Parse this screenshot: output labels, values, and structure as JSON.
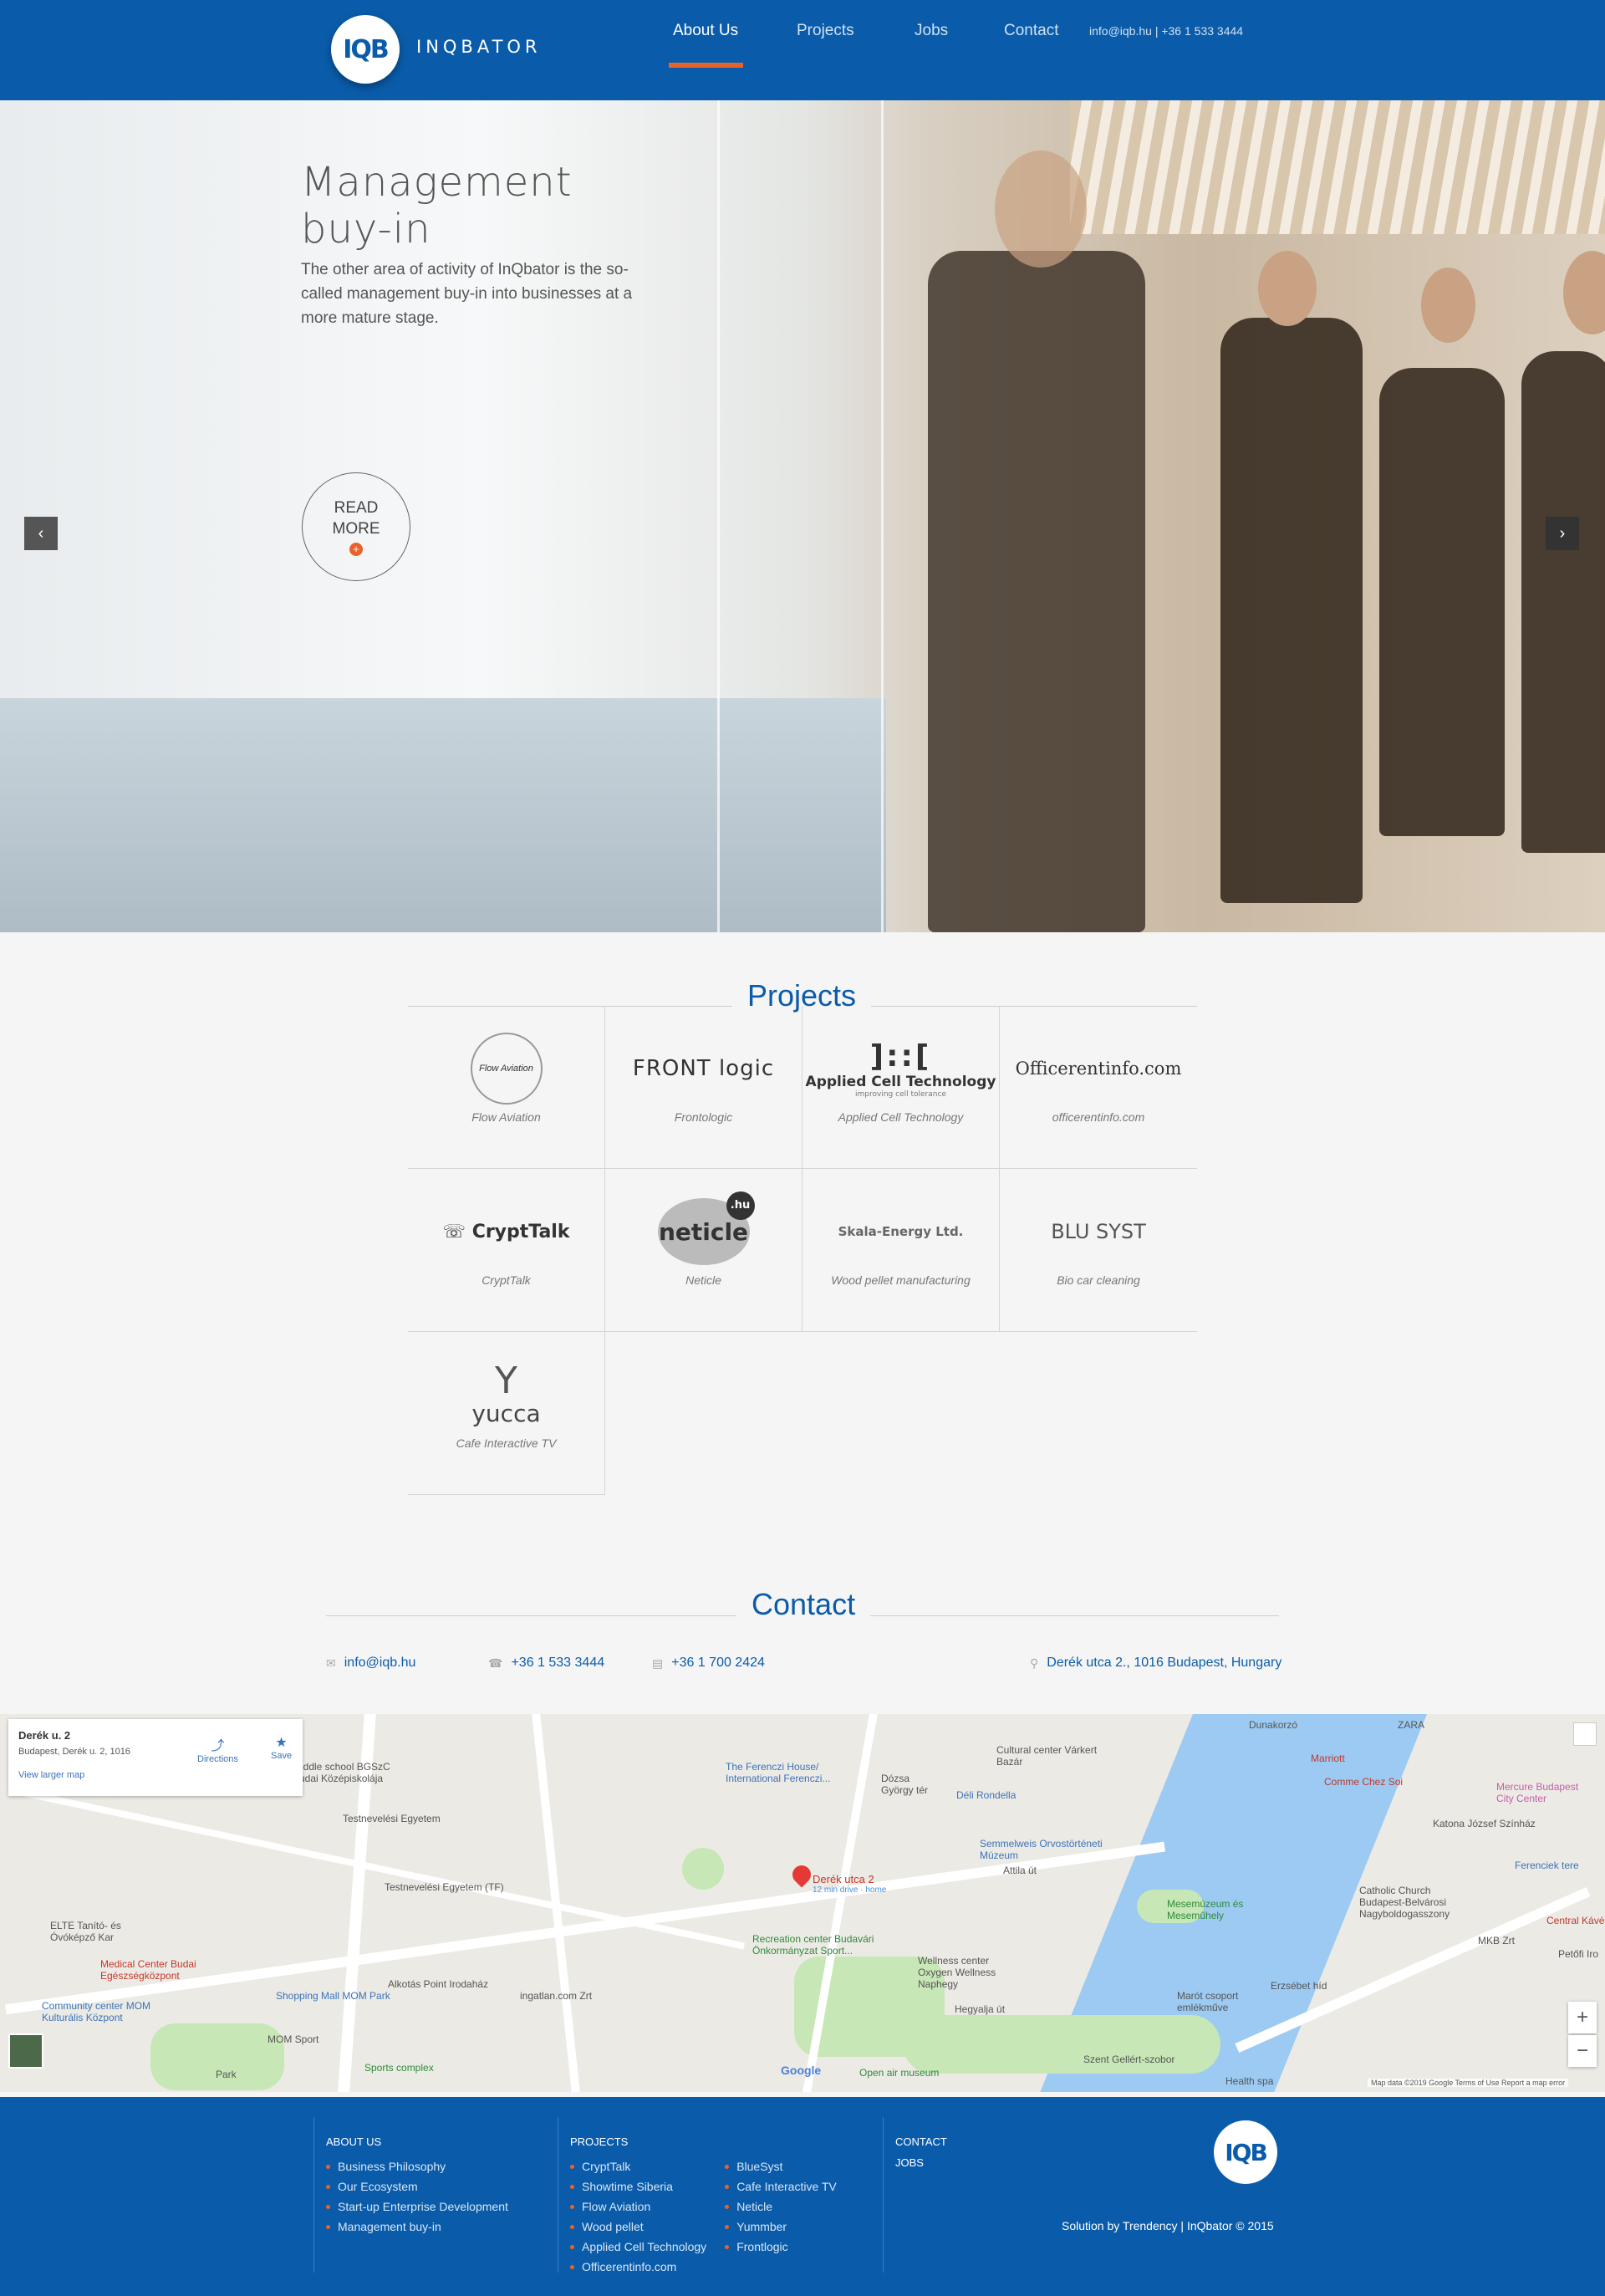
{
  "header": {
    "logo_text": "IQB",
    "brand": "INQBATOR",
    "nav": [
      "About Us",
      "Projects",
      "Jobs",
      "Contact"
    ],
    "contact": "info@iqb.hu | +36 1 533 3444"
  },
  "hero": {
    "title_line1": "Management",
    "title_line2": "buy-in",
    "text": "The other area of activity of InQbator is the so-called management buy-in into businesses at a more mature stage.",
    "read_more_line1": "READ",
    "read_more_line2": "MORE",
    "plus": "+",
    "prev": "‹",
    "next": "›"
  },
  "projects": {
    "title": "Projects",
    "items": [
      {
        "logo": "Flow Aviation",
        "label": "Flow Aviation"
      },
      {
        "logo": "FRONT logic",
        "label": "Frontologic"
      },
      {
        "logo": "Applied Cell Technology",
        "label": "Applied Cell Technology",
        "tagline": "improving cell tolerance"
      },
      {
        "logo": "Officerentinfo.com",
        "label": "officerentinfo.com"
      },
      {
        "logo": "CryptTalk",
        "label": "CryptTalk"
      },
      {
        "logo": "neticle",
        "label": "Neticle",
        "badge": ".hu"
      },
      {
        "logo": "Skala-Energy Ltd.",
        "label": "Wood pellet manufacturing"
      },
      {
        "logo": "BLU SYST",
        "label": "Bio car cleaning"
      },
      {
        "logo": "yucca",
        "label": "Cafe Interactive TV"
      }
    ]
  },
  "contact": {
    "title": "Contact",
    "email": "info@iqb.hu",
    "phone": "+36 1 533 3444",
    "fax": "+36 1 700 2424",
    "address": "Derék utca 2., 1016 Budapest, Hungary"
  },
  "map": {
    "card_title": "Derék u. 2",
    "card_address": "Budapest, Derék u. 2, 1016",
    "directions": "Directions",
    "save": "Save",
    "larger_map": "View larger map",
    "pin_label": "Derék utca 2",
    "pin_sub": "12 min drive · home",
    "labels": [
      "Middle school BGSzC Budai Középiskolája",
      "Testnevelési Egyetem",
      "Testnevelési Egyetem (TF)",
      "ELTE Tanító- és Óvóképző Kar",
      "Medical Center Budai Egészségközpont",
      "Community center MOM Kulturális Központ",
      "Shopping Mall MOM Park",
      "MOM Sport",
      "Alkotás Point Irodaház",
      "ingatlan.com Zrt",
      "Sports complex",
      "Park",
      "The Ferenczi House/ International Ferenczi...",
      "Cultural center Várkert Bazár",
      "Dózsa György tér",
      "Déli Rondella",
      "Semmelweis Orvostörténeti Múzeum",
      "Recreation center Budavári Önkormányzat Sport...",
      "Wellness center Oxygen Wellness Naphegy",
      "Open air museum",
      "Mesemúzeum és Meseműhely",
      "Marót csoport emlékműve",
      "Szent Gellért-szobor",
      "Erzsébet híd",
      "Health spa",
      "Catholic Church Budapest-Belvárosi Nagyboldogasszony",
      "Katona József Színház",
      "Mercure Budapest City Center",
      "Comme Chez Soi",
      "Marriott",
      "ZARA",
      "Dunakorzó",
      "Ferenciek tere",
      "MKB Zrt",
      "Central Kávé",
      "Petőfi Iro",
      "Hegyalja út",
      "Attila út",
      "Google"
    ],
    "footer": "Map data ©2019 Google   Terms of Use   Report a map error",
    "zoom_in": "+",
    "zoom_out": "−"
  },
  "footer": {
    "about_head": "ABOUT US",
    "about_items": [
      "Business Philosophy",
      "Our Ecosystem",
      "Start-up Enterprise Development",
      "Management buy-in"
    ],
    "projects_head": "PROJECTS",
    "projects_col1": [
      "CryptTalk",
      "Showtime Siberia",
      "Flow Aviation",
      "Wood pellet",
      "Applied Cell Technology",
      "Officerentinfo.com"
    ],
    "projects_col2": [
      "BlueSyst",
      "Cafe Interactive TV",
      "Neticle",
      "Yummber",
      "Frontlogic"
    ],
    "contact_head": "CONTACT",
    "jobs_head": "JOBS",
    "logo_text": "IQB",
    "copyright": "Solution by Trendency | InQbator © 2015"
  }
}
